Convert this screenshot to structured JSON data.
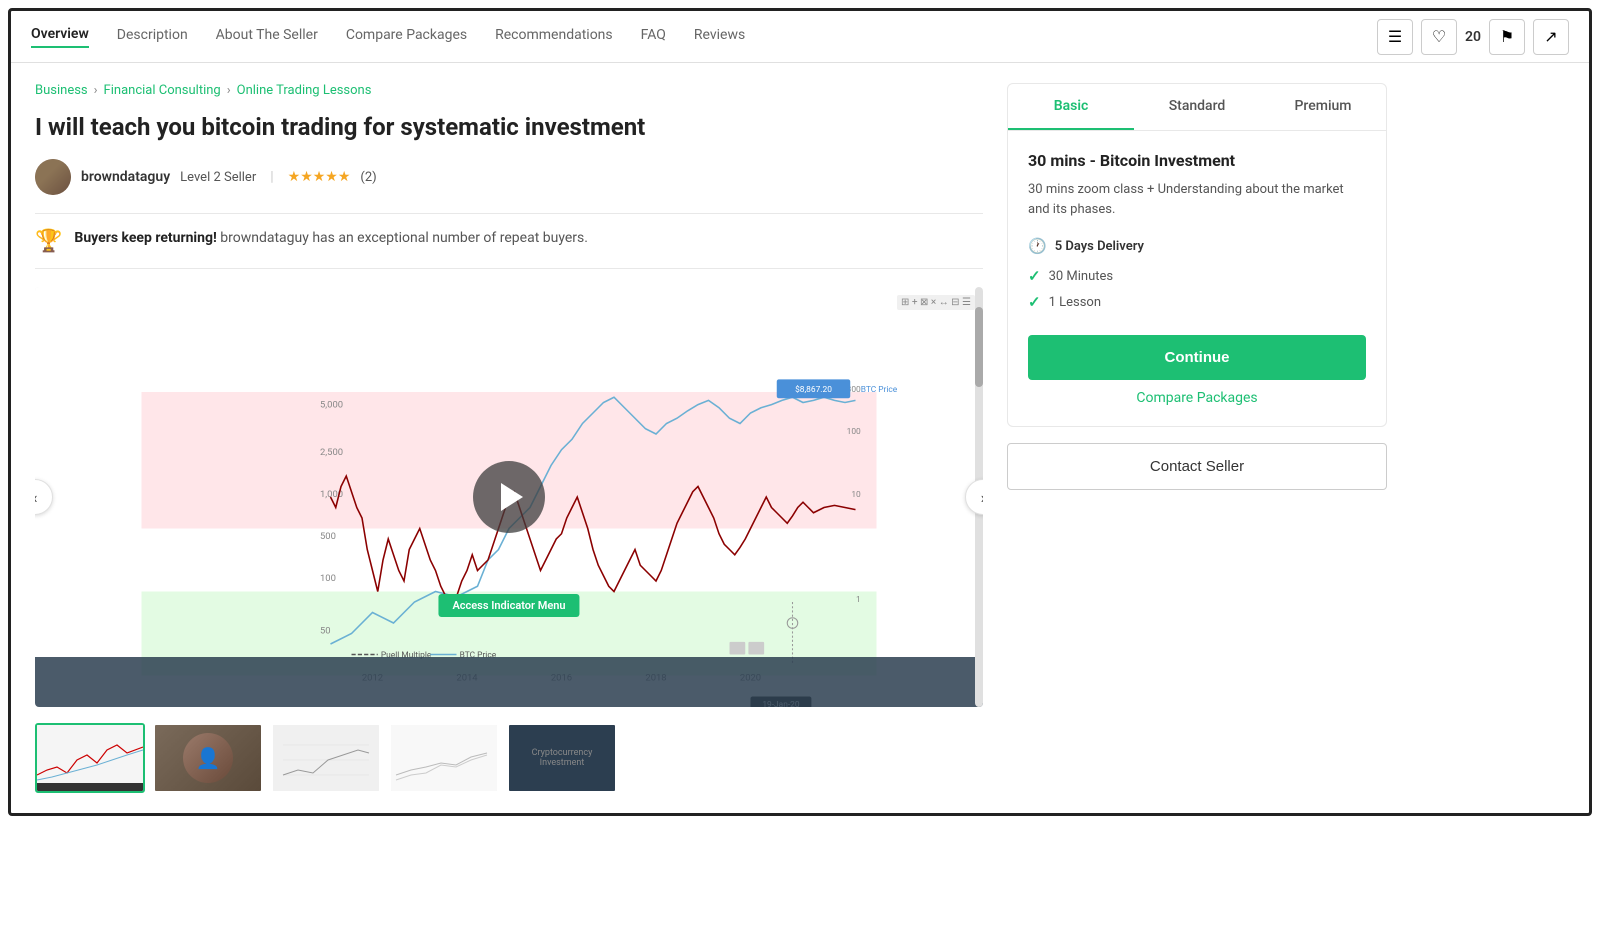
{
  "nav": {
    "links": [
      {
        "label": "Overview",
        "active": true
      },
      {
        "label": "Description",
        "active": false
      },
      {
        "label": "About The Seller",
        "active": false
      },
      {
        "label": "Compare Packages",
        "active": false
      },
      {
        "label": "Recommendations",
        "active": false
      },
      {
        "label": "FAQ",
        "active": false
      },
      {
        "label": "Reviews",
        "active": false
      }
    ],
    "like_count": "20"
  },
  "breadcrumb": {
    "items": [
      "Business",
      "Financial Consulting",
      "Online Trading Lessons"
    ]
  },
  "gig": {
    "title": "I will teach you bitcoin trading for systematic investment",
    "seller": {
      "name": "browndataguy",
      "level": "Level 2 Seller",
      "rating": "5",
      "review_count": "(2)"
    },
    "repeat_buyers_text": "Buyers keep returning!",
    "repeat_buyers_detail": " browndataguy has an exceptional number of repeat buyers.",
    "indicator_btn": "Access Indicator Menu"
  },
  "package": {
    "tabs": [
      "Basic",
      "Standard",
      "Premium"
    ],
    "active_tab": "Basic",
    "title": "30 mins - Bitcoin Investment",
    "description": "30 mins zoom class + Understanding about the market and its phases.",
    "delivery": "5 Days Delivery",
    "features": [
      "30 Minutes",
      "1 Lesson"
    ],
    "continue_btn": "Continue",
    "compare_link": "Compare Packages"
  },
  "contact_btn": "Contact Seller"
}
